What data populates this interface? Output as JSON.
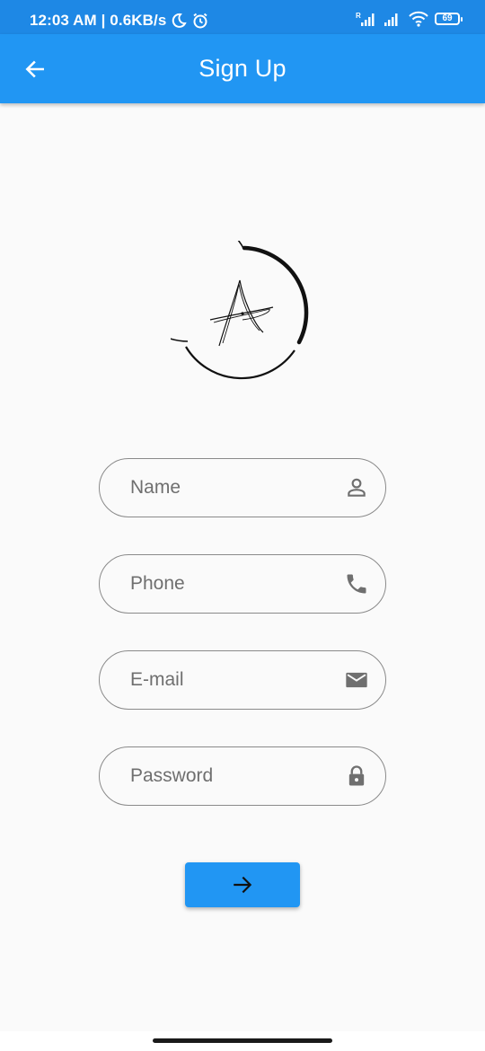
{
  "status_bar": {
    "time_speed": "12:03 AM | 0.6KB/s",
    "network_label": "R",
    "battery": "69",
    "background_color": "#1e88e5"
  },
  "app_bar": {
    "title": "Sign Up",
    "back_icon": "arrow-left-icon",
    "background_color": "#2196f3"
  },
  "logo": {
    "icon": "signature-a-logo"
  },
  "form": {
    "fields": [
      {
        "placeholder": "Name",
        "value": "",
        "icon": "person-outline-icon"
      },
      {
        "placeholder": "Phone",
        "value": "",
        "icon": "phone-icon"
      },
      {
        "placeholder": "E-mail",
        "value": "",
        "icon": "mail-icon"
      },
      {
        "placeholder": "Password",
        "value": "",
        "icon": "lock-icon"
      }
    ],
    "submit_icon": "arrow-right-icon",
    "accent_color": "#2196f3"
  }
}
